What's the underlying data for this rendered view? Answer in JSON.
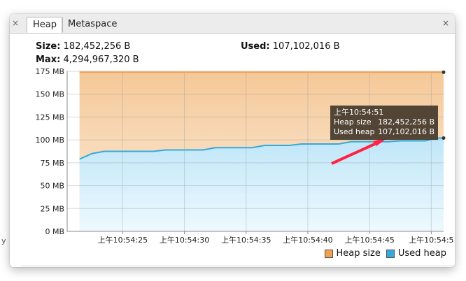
{
  "tabs": {
    "close_left": "×",
    "heap_label": "Heap",
    "metaspace_label": "Metaspace",
    "close_right": "×"
  },
  "stats": {
    "size_label": "Size:",
    "size_value": "182,452,256 B",
    "used_label": "Used:",
    "used_value": "107,102,016 B",
    "max_label": "Max:",
    "max_value": "4,294,967,320 B"
  },
  "colors": {
    "heap_size": "#f0a050",
    "used_heap": "#33aadd",
    "arrow": "#ff2244"
  },
  "tooltip": {
    "time": "上午10:54:51",
    "heap_label": "Heap size",
    "heap_value": "182,452,256 B",
    "used_label": "Used heap",
    "used_value": "107,102,016 B"
  },
  "legend": {
    "heap_label": "Heap size",
    "used_label": "Used heap"
  },
  "left_mark": "y",
  "chart_data": {
    "type": "area",
    "y_ticks": [
      "0 MB",
      "25 MB",
      "50 MB",
      "75 MB",
      "100 MB",
      "125 MB",
      "150 MB",
      "175 MB"
    ],
    "x_ticks": [
      "上午10:54:25",
      "上午10:54:30",
      "上午10:54:35",
      "上午10:54:40",
      "上午10:54:45",
      "上午10:54:5"
    ],
    "ylim": [
      0,
      175
    ],
    "x_seconds": [
      21.5,
      22.5,
      23.5,
      24.5,
      25.5,
      26.5,
      27.5,
      28.5,
      29.5,
      30.5,
      31.5,
      32.5,
      33.5,
      34.5,
      35.5,
      36.5,
      37.5,
      38.5,
      39.5,
      40.5,
      41.5,
      42.5,
      43.5,
      44.5,
      45.5,
      46.5,
      47.5,
      48.5,
      49.5,
      50.5,
      51.0
    ],
    "series": [
      {
        "name": "Heap size",
        "values": [
          174,
          174,
          174,
          174,
          174,
          174,
          174,
          174,
          174,
          174,
          174,
          174,
          174,
          174,
          174,
          174,
          174,
          174,
          174,
          174,
          174,
          174,
          174,
          174,
          174,
          174,
          174,
          174,
          174,
          174,
          174
        ]
      },
      {
        "name": "Used heap",
        "values": [
          79,
          85,
          87.5,
          87.5,
          87.5,
          87.5,
          87.5,
          89,
          89,
          89,
          89,
          91.5,
          91.5,
          91.5,
          91.5,
          94,
          94,
          94,
          95.5,
          95.5,
          95.5,
          95.5,
          98,
          98,
          98,
          98,
          99,
          99,
          99,
          102,
          102
        ]
      }
    ],
    "grid": true,
    "legend_position": "bottom-right"
  }
}
